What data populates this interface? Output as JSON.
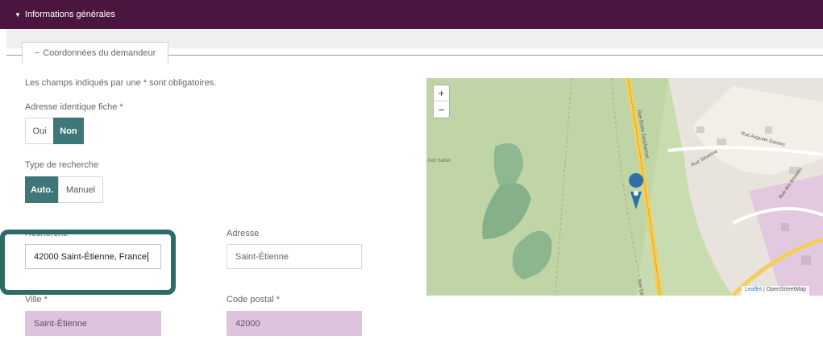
{
  "header": {
    "title": "Informations générales"
  },
  "fieldset": {
    "legend": "Coordonnées du demandeur"
  },
  "hint": "Les champs indiqués par une * sont obligatoires.",
  "adresse_identique": {
    "label": "Adresse identique fiche *",
    "options": [
      "Oui",
      "Non"
    ],
    "selected": "Non"
  },
  "type_recherche": {
    "label": "Type de recherche",
    "options": [
      "Auto.",
      "Manuel"
    ],
    "selected": "Auto."
  },
  "recherche": {
    "label": "Recherche",
    "value": "42000 Saint-Étienne, France"
  },
  "adresse": {
    "label": "Adresse",
    "value": "Saint-Étienne"
  },
  "ville": {
    "label": "Ville *",
    "value": "Saint-Étienne"
  },
  "code_postal": {
    "label": "Code postal *",
    "value": "42000"
  },
  "map": {
    "zoom_in": "+",
    "zoom_out": "−",
    "attribution_leaflet": "Leaflet",
    "attribution_sep": " | ",
    "attribution_osm": "OpenStreetMap",
    "street_labels": [
      "Rue Émile Deschamps",
      "Rue Auguste Daviers",
      "Rue des Brosses",
      "Rue Dechaux",
      "Rue Séverine"
    ],
    "place_label": "font Sallon",
    "marker_color": "#2f6fa8"
  },
  "colors": {
    "header": "#4a1640",
    "accent": "#3e7777",
    "readonly": "#dcc4dc",
    "highlight": "#2d6b68"
  }
}
